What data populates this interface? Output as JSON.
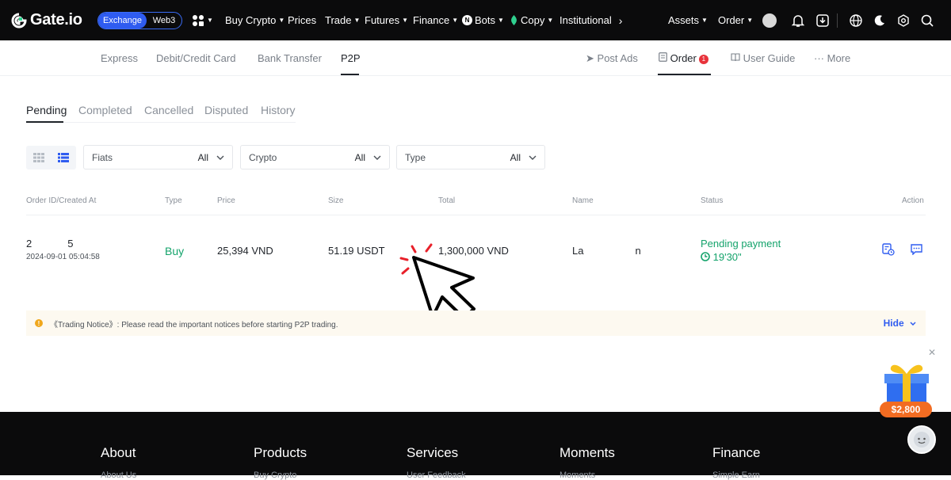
{
  "topbar": {
    "logo": "Gate.io",
    "mode_exchange": "Exchange",
    "mode_web3": "Web3",
    "nav": [
      "Buy Crypto",
      "Prices",
      "Trade",
      "Futures",
      "Finance",
      "Bots",
      "Copy",
      "Institutional"
    ],
    "assets": "Assets",
    "order": "Order"
  },
  "subnav": {
    "items": [
      "Express",
      "Debit/Credit Card",
      "Bank Transfer",
      "P2P"
    ],
    "active": "P2P",
    "post_ads": "Post Ads",
    "order": "Order",
    "order_badge": "1",
    "user_guide": "User Guide",
    "more": "More"
  },
  "tabs": {
    "items": [
      "Pending",
      "Completed",
      "Cancelled",
      "Disputed",
      "History"
    ],
    "active": "Pending"
  },
  "filters": [
    {
      "label": "Fiats",
      "value": "All"
    },
    {
      "label": "Crypto",
      "value": "All"
    },
    {
      "label": "Type",
      "value": "All"
    }
  ],
  "table": {
    "headers": [
      "Order ID/Created At",
      "Type",
      "Price",
      "Size",
      "Total",
      "Name",
      "Status",
      "Action"
    ],
    "rows": [
      {
        "order_id_start": "2",
        "order_id_end": "5",
        "created_at": "2024-09-01 05:04:58",
        "type": "Buy",
        "price": "25,394 VND",
        "size": "51.19 USDT",
        "total": "1,300,000 VND",
        "name_start": "La",
        "name_end": "n",
        "status": "Pending payment",
        "timer": "19'30\""
      }
    ]
  },
  "notice": {
    "text": "《Trading Notice》: Please read the important notices before starting P2P trading.",
    "hide": "Hide"
  },
  "footer": {
    "columns": [
      "About",
      "Products",
      "Services",
      "Moments",
      "Finance"
    ],
    "sub": [
      "About Us",
      "Buy Crypto",
      "User Feedback",
      "Moments",
      "Simple Earn"
    ]
  },
  "promo": {
    "amount": "$2,800"
  },
  "colors": {
    "topbar_bg": "#0b0b0c",
    "accent_blue": "#2f5cf0",
    "buy_green": "#14a36b",
    "badge_red": "#e8333b",
    "notice_bg": "#fdf9f0",
    "gift_orange": "#f26c22"
  }
}
